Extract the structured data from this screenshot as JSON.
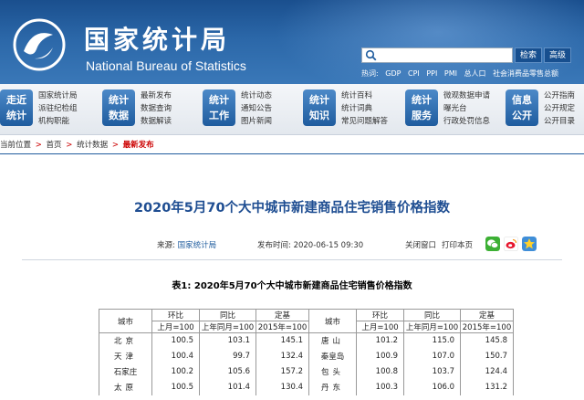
{
  "header": {
    "title_cn": "国家统计局",
    "title_en": "National Bureau of Statistics",
    "search_placeholder": "",
    "search_label": "检索",
    "advanced_label": "高级",
    "hot_words": [
      "热词:",
      "GDP",
      "CPI",
      "PPI",
      "PMI",
      "总人口",
      "社会消费品零售总额"
    ]
  },
  "nav": [
    {
      "tile": [
        "走近",
        "统计"
      ],
      "links": [
        "国家统计局",
        "派驻纪检组",
        "机构职能"
      ]
    },
    {
      "tile": [
        "统计",
        "数据"
      ],
      "links": [
        "最新发布",
        "数据查询",
        "数据解读"
      ]
    },
    {
      "tile": [
        "统计",
        "工作"
      ],
      "links": [
        "统计动态",
        "通知公告",
        "图片新闻"
      ]
    },
    {
      "tile": [
        "统计",
        "知识"
      ],
      "links": [
        "统计百科",
        "统计词典",
        "常见问题解答"
      ]
    },
    {
      "tile": [
        "统计",
        "服务"
      ],
      "links": [
        "微观数据申请",
        "曝光台",
        "行政处罚信息"
      ]
    },
    {
      "tile": [
        "信息",
        "公开"
      ],
      "links": [
        "公开指南",
        "公开规定",
        "公开目录"
      ]
    }
  ],
  "breadcrumb": {
    "prefix": "当前位置",
    "items": [
      "首页",
      "统计数据"
    ],
    "current": "最新发布",
    "separator": ">"
  },
  "article": {
    "title": "2020年5月70个大中城市新建商品住宅销售价格指数",
    "source_label": "来源:",
    "source": "国家统计局",
    "time_label": "发布时间:",
    "time": "2020-06-15 09:30",
    "close_label": "关闭窗口",
    "print_label": "打印本页",
    "table_caption": "表1:  2020年5月70个大中城市新建商品住宅销售价格指数"
  },
  "table": {
    "city_header": "城市",
    "group_headers": [
      "环比",
      "同比",
      "定基"
    ],
    "sub_headers": [
      "上月=100",
      "上年同月=100",
      "2015年=100"
    ],
    "left_rows": [
      [
        "北京",
        "100.5",
        "103.1",
        "145.1"
      ],
      [
        "天津",
        "100.4",
        "99.7",
        "132.4"
      ],
      [
        "石家庄",
        "100.2",
        "105.6",
        "157.2"
      ],
      [
        "太原",
        "100.5",
        "101.4",
        "130.4"
      ]
    ],
    "right_rows": [
      [
        "唐山",
        "101.2",
        "115.0",
        "145.8"
      ],
      [
        "秦皇岛",
        "100.9",
        "107.0",
        "150.7"
      ],
      [
        "包头",
        "100.8",
        "103.7",
        "124.4"
      ],
      [
        "丹东",
        "100.3",
        "106.0",
        "131.2"
      ]
    ]
  },
  "colors": {
    "brand_blue": "#1f5c9e",
    "title_blue": "#1f4e92",
    "breadcrumb_red": "#cc0000"
  },
  "icons": [
    "search-icon",
    "wechat-icon",
    "weibo-icon",
    "qzone-icon",
    "nbs-logo-icon"
  ]
}
